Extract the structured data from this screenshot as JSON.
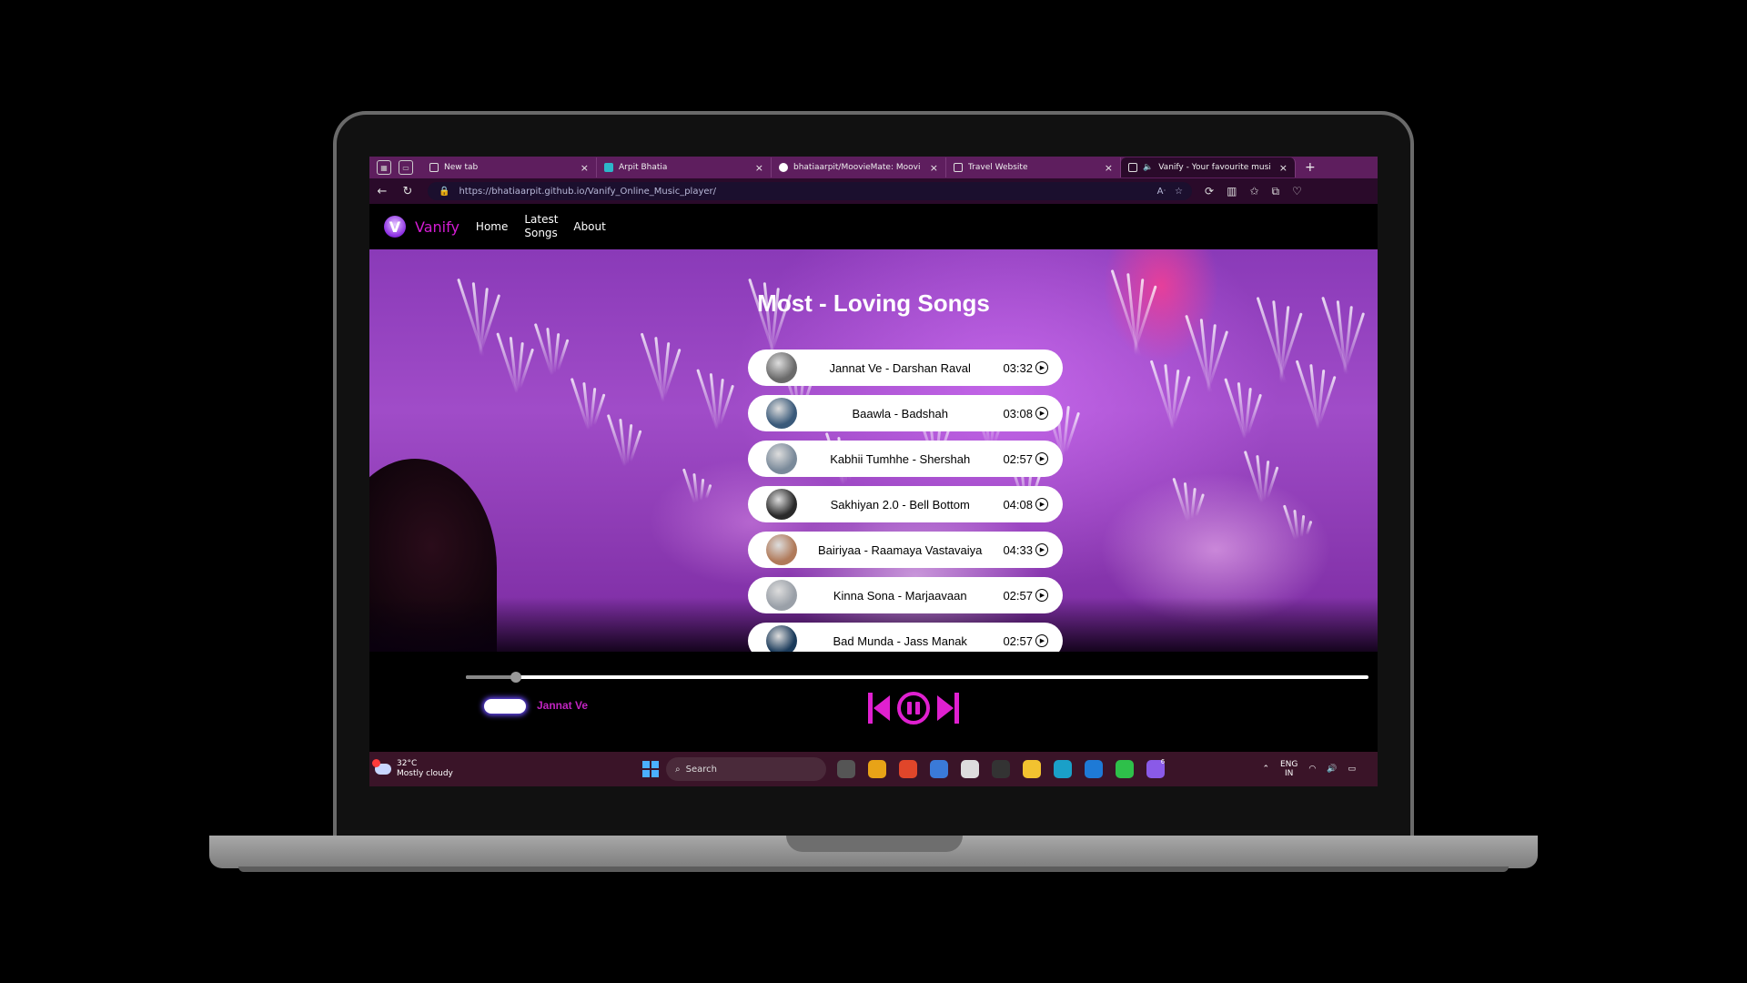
{
  "browser": {
    "tabs": [
      {
        "title": "New tab",
        "favicon": "page-icon",
        "active": false
      },
      {
        "title": "Arpit Bhatia",
        "favicon": "ab-logo-icon",
        "active": false
      },
      {
        "title": "bhatiaarpit/MoovieMate: Moovi",
        "favicon": "github-icon",
        "active": false
      },
      {
        "title": "Travel Website",
        "favicon": "page-icon",
        "active": false
      },
      {
        "title": "Vanify - Your favourite musi",
        "favicon": "page-icon",
        "active": true
      }
    ],
    "close_glyph": "×",
    "new_tab_glyph": "+",
    "url": "https://bhatiaarpit.github.io/Vanify_Online_Music_player/"
  },
  "site": {
    "brand_letter": "V",
    "brand": "Vanify",
    "nav": [
      "Home",
      "Latest Songs",
      "About"
    ],
    "heading": "Most - Loving Songs",
    "songs": [
      {
        "name": "Jannat Ve - Darshan Raval",
        "duration": "03:32",
        "thumb_color": "#6a6a6a"
      },
      {
        "name": "Baawla - Badshah",
        "duration": "03:08",
        "thumb_color": "#3a5a7a"
      },
      {
        "name": "Kabhii Tumhhe - Shershah",
        "duration": "02:57",
        "thumb_color": "#7a8a9a"
      },
      {
        "name": "Sakhiyan 2.0 - Bell Bottom",
        "duration": "04:08",
        "thumb_color": "#2a2a2a"
      },
      {
        "name": "Bairiyaa - Raamaya Vastavaiya",
        "duration": "04:33",
        "thumb_color": "#b07a5a"
      },
      {
        "name": "Kinna Sona - Marjaavaan",
        "duration": "02:57",
        "thumb_color": "#9aa0a8"
      },
      {
        "name": "Bad Munda - Jass Manak",
        "duration": "02:57",
        "thumb_color": "#1a3a5a"
      }
    ],
    "player": {
      "now_playing": "Jannat Ve",
      "progress": 0.055,
      "accent_color": "#e020d0"
    }
  },
  "taskbar": {
    "temperature": "32°C",
    "weather": "Mostly cloudy",
    "search_label": "Search",
    "language": "ENG",
    "region": "IN",
    "apps": [
      {
        "icon": "task-view-icon",
        "color": "#555"
      },
      {
        "icon": "chrome-icon",
        "color": "#e8a317"
      },
      {
        "icon": "brave-icon",
        "color": "#e0462a"
      },
      {
        "icon": "snipping-tool-icon",
        "color": "#3a7ad8"
      },
      {
        "icon": "ms-store-icon",
        "color": "#ddd"
      },
      {
        "icon": "dell-icon",
        "color": "#333"
      },
      {
        "icon": "file-explorer-icon",
        "color": "#f2c230"
      },
      {
        "icon": "edge-icon",
        "color": "#1aa0c8"
      },
      {
        "icon": "vscode-icon",
        "color": "#1e7ad6"
      },
      {
        "icon": "whatsapp-icon",
        "color": "#2ec04a"
      },
      {
        "icon": "copilot-icon",
        "color": "#8a5ae8"
      }
    ],
    "copilot_badge": "6"
  }
}
